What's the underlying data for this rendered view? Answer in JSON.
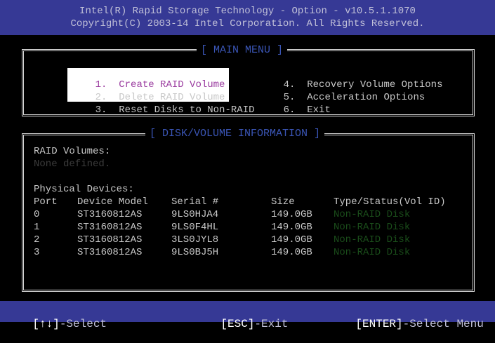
{
  "header": {
    "title": "Intel(R) Rapid Storage Technology - Option - v10.5.1.1070",
    "copyright": "Copyright(C) 2003-14 Intel Corporation. All Rights Reserved."
  },
  "main_menu": {
    "title": "[ MAIN MENU ]",
    "items": [
      {
        "num": "1.",
        "label": "Create RAID Volume"
      },
      {
        "num": "2.",
        "label": "Delete RAID Volume"
      },
      {
        "num": "3.",
        "label": "Reset Disks to Non-RAID"
      },
      {
        "num": "4.",
        "label": "Recovery Volume Options"
      },
      {
        "num": "5.",
        "label": "Acceleration Options"
      },
      {
        "num": "6.",
        "label": "Exit"
      }
    ],
    "selected_index": 0
  },
  "disk_info": {
    "title": "[ DISK/VOLUME INFORMATION ]",
    "raid_volumes_label": "RAID Volumes:",
    "raid_volumes_value": "None defined.",
    "physical_devices_label": "Physical Devices:",
    "columns": [
      "Port",
      "Device Model",
      "Serial #",
      "Size",
      "Type/Status(Vol ID)"
    ],
    "rows": [
      {
        "port": "0",
        "model": "ST3160812AS",
        "serial": "9LS0HJA4",
        "size": "149.0GB",
        "status": "Non-RAID Disk"
      },
      {
        "port": "1",
        "model": "ST3160812AS",
        "serial": "9LS0F4HL",
        "size": "149.0GB",
        "status": "Non-RAID Disk"
      },
      {
        "port": "2",
        "model": "ST3160812AS",
        "serial": "3LS0JYL8",
        "size": "149.0GB",
        "status": "Non-RAID Disk"
      },
      {
        "port": "3",
        "model": "ST3160812AS",
        "serial": "9LS0BJ5H",
        "size": "149.0GB",
        "status": "Non-RAID Disk"
      }
    ]
  },
  "footer": {
    "hint1_key": "[↑↓]",
    "hint1_text": "-Select",
    "hint2_key": "[ESC]",
    "hint2_text": "-Exit",
    "hint3_key": "[ENTER]",
    "hint3_text": "-Select Menu"
  },
  "colors": {
    "header_bg": "#363995",
    "box_title": "#3a55b5",
    "selected_text": "#9a3b9f",
    "status_text": "#1a4d1a"
  }
}
